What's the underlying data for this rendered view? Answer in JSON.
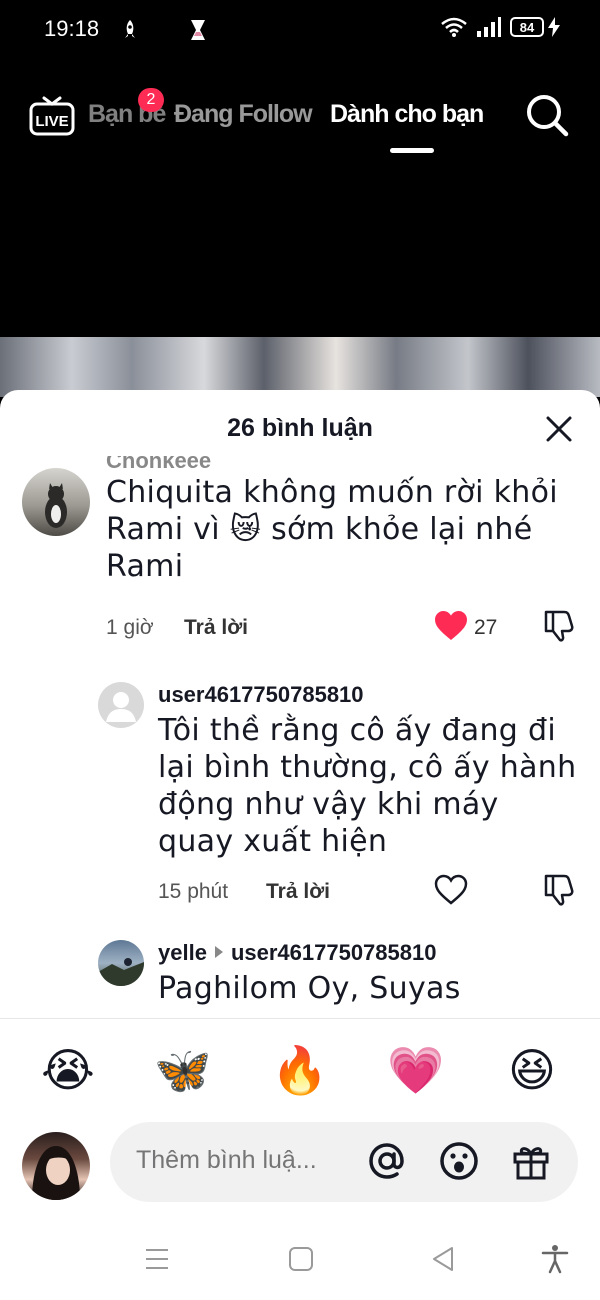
{
  "status_bar": {
    "time": "19:18",
    "battery": "84"
  },
  "top_nav": {
    "live_label": "LIVE",
    "friends_tab": "Bạn bè",
    "friends_badge": "2",
    "following_tab": "Đang Follow",
    "foryou_tab": "Dành cho bạn"
  },
  "sheet": {
    "title": "26 bình luận"
  },
  "comments": [
    {
      "username": "Chonkeee",
      "text": "Chiquita không muốn rời khỏi Rami vì 😿 sớm khỏe lại nhé Rami",
      "time": "1 giờ",
      "reply_label": "Trả lời",
      "likes": "27",
      "liked": true
    }
  ],
  "replies": [
    {
      "username": "user4617750785810",
      "text": "Tôi thề rằng cô ấy đang đi lại bình thường, cô ấy hành động như vậy khi máy quay xuất hiện",
      "time": "15 phút",
      "reply_label": "Trả lời",
      "liked": false
    },
    {
      "username": "yelle",
      "reply_to": "user4617750785810",
      "text": "Paghilom Oy, Suyas"
    }
  ],
  "emoji_bar": [
    "😭",
    "🦋",
    "🔥",
    "💗",
    "😆"
  ],
  "composer": {
    "placeholder": "Thêm bình luậ..."
  },
  "colors": {
    "accent": "#fe2c55",
    "text": "#161823",
    "input_bg": "#f1f1f2"
  }
}
